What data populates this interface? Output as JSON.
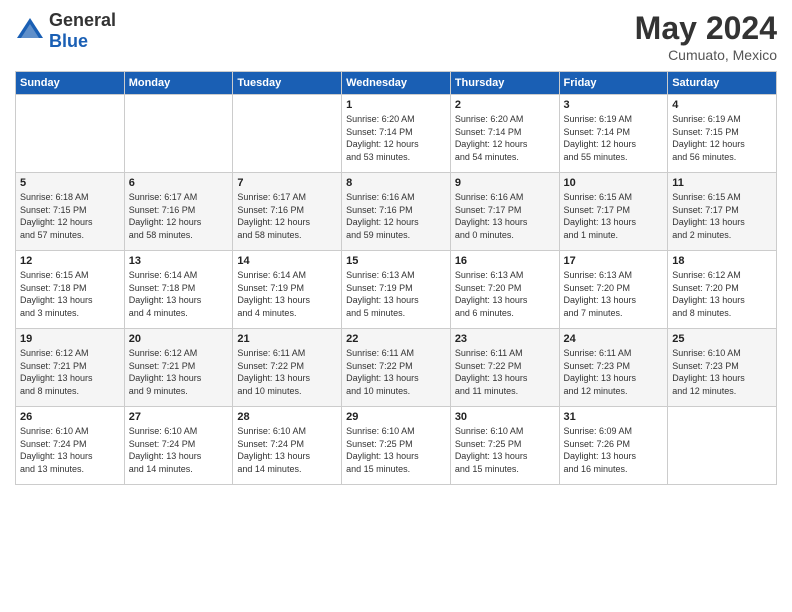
{
  "header": {
    "logo_general": "General",
    "logo_blue": "Blue",
    "month_year": "May 2024",
    "location": "Cumuato, Mexico"
  },
  "weekdays": [
    "Sunday",
    "Monday",
    "Tuesday",
    "Wednesday",
    "Thursday",
    "Friday",
    "Saturday"
  ],
  "weeks": [
    [
      {
        "day": "",
        "info": ""
      },
      {
        "day": "",
        "info": ""
      },
      {
        "day": "",
        "info": ""
      },
      {
        "day": "1",
        "info": "Sunrise: 6:20 AM\nSunset: 7:14 PM\nDaylight: 12 hours\nand 53 minutes."
      },
      {
        "day": "2",
        "info": "Sunrise: 6:20 AM\nSunset: 7:14 PM\nDaylight: 12 hours\nand 54 minutes."
      },
      {
        "day": "3",
        "info": "Sunrise: 6:19 AM\nSunset: 7:14 PM\nDaylight: 12 hours\nand 55 minutes."
      },
      {
        "day": "4",
        "info": "Sunrise: 6:19 AM\nSunset: 7:15 PM\nDaylight: 12 hours\nand 56 minutes."
      }
    ],
    [
      {
        "day": "5",
        "info": "Sunrise: 6:18 AM\nSunset: 7:15 PM\nDaylight: 12 hours\nand 57 minutes."
      },
      {
        "day": "6",
        "info": "Sunrise: 6:17 AM\nSunset: 7:16 PM\nDaylight: 12 hours\nand 58 minutes."
      },
      {
        "day": "7",
        "info": "Sunrise: 6:17 AM\nSunset: 7:16 PM\nDaylight: 12 hours\nand 58 minutes."
      },
      {
        "day": "8",
        "info": "Sunrise: 6:16 AM\nSunset: 7:16 PM\nDaylight: 12 hours\nand 59 minutes."
      },
      {
        "day": "9",
        "info": "Sunrise: 6:16 AM\nSunset: 7:17 PM\nDaylight: 13 hours\nand 0 minutes."
      },
      {
        "day": "10",
        "info": "Sunrise: 6:15 AM\nSunset: 7:17 PM\nDaylight: 13 hours\nand 1 minute."
      },
      {
        "day": "11",
        "info": "Sunrise: 6:15 AM\nSunset: 7:17 PM\nDaylight: 13 hours\nand 2 minutes."
      }
    ],
    [
      {
        "day": "12",
        "info": "Sunrise: 6:15 AM\nSunset: 7:18 PM\nDaylight: 13 hours\nand 3 minutes."
      },
      {
        "day": "13",
        "info": "Sunrise: 6:14 AM\nSunset: 7:18 PM\nDaylight: 13 hours\nand 4 minutes."
      },
      {
        "day": "14",
        "info": "Sunrise: 6:14 AM\nSunset: 7:19 PM\nDaylight: 13 hours\nand 4 minutes."
      },
      {
        "day": "15",
        "info": "Sunrise: 6:13 AM\nSunset: 7:19 PM\nDaylight: 13 hours\nand 5 minutes."
      },
      {
        "day": "16",
        "info": "Sunrise: 6:13 AM\nSunset: 7:20 PM\nDaylight: 13 hours\nand 6 minutes."
      },
      {
        "day": "17",
        "info": "Sunrise: 6:13 AM\nSunset: 7:20 PM\nDaylight: 13 hours\nand 7 minutes."
      },
      {
        "day": "18",
        "info": "Sunrise: 6:12 AM\nSunset: 7:20 PM\nDaylight: 13 hours\nand 8 minutes."
      }
    ],
    [
      {
        "day": "19",
        "info": "Sunrise: 6:12 AM\nSunset: 7:21 PM\nDaylight: 13 hours\nand 8 minutes."
      },
      {
        "day": "20",
        "info": "Sunrise: 6:12 AM\nSunset: 7:21 PM\nDaylight: 13 hours\nand 9 minutes."
      },
      {
        "day": "21",
        "info": "Sunrise: 6:11 AM\nSunset: 7:22 PM\nDaylight: 13 hours\nand 10 minutes."
      },
      {
        "day": "22",
        "info": "Sunrise: 6:11 AM\nSunset: 7:22 PM\nDaylight: 13 hours\nand 10 minutes."
      },
      {
        "day": "23",
        "info": "Sunrise: 6:11 AM\nSunset: 7:22 PM\nDaylight: 13 hours\nand 11 minutes."
      },
      {
        "day": "24",
        "info": "Sunrise: 6:11 AM\nSunset: 7:23 PM\nDaylight: 13 hours\nand 12 minutes."
      },
      {
        "day": "25",
        "info": "Sunrise: 6:10 AM\nSunset: 7:23 PM\nDaylight: 13 hours\nand 12 minutes."
      }
    ],
    [
      {
        "day": "26",
        "info": "Sunrise: 6:10 AM\nSunset: 7:24 PM\nDaylight: 13 hours\nand 13 minutes."
      },
      {
        "day": "27",
        "info": "Sunrise: 6:10 AM\nSunset: 7:24 PM\nDaylight: 13 hours\nand 14 minutes."
      },
      {
        "day": "28",
        "info": "Sunrise: 6:10 AM\nSunset: 7:24 PM\nDaylight: 13 hours\nand 14 minutes."
      },
      {
        "day": "29",
        "info": "Sunrise: 6:10 AM\nSunset: 7:25 PM\nDaylight: 13 hours\nand 15 minutes."
      },
      {
        "day": "30",
        "info": "Sunrise: 6:10 AM\nSunset: 7:25 PM\nDaylight: 13 hours\nand 15 minutes."
      },
      {
        "day": "31",
        "info": "Sunrise: 6:09 AM\nSunset: 7:26 PM\nDaylight: 13 hours\nand 16 minutes."
      },
      {
        "day": "",
        "info": ""
      }
    ]
  ]
}
